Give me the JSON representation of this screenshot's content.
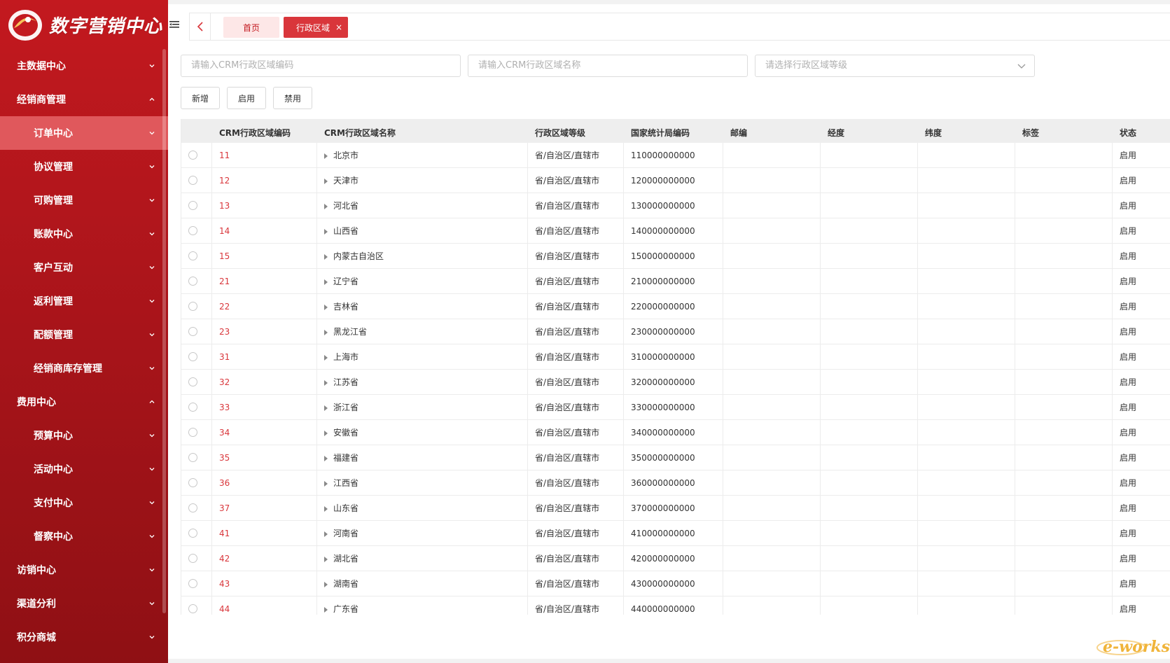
{
  "sidebar": {
    "logo_text": "数字营销中心",
    "items": [
      {
        "label": "主数据中心",
        "level": 1,
        "expanded": false
      },
      {
        "label": "经销商管理",
        "level": 1,
        "expanded": true
      },
      {
        "label": "订单中心",
        "level": 2,
        "expanded": false,
        "active": true
      },
      {
        "label": "协议管理",
        "level": 2,
        "expanded": false
      },
      {
        "label": "可购管理",
        "level": 2,
        "expanded": false
      },
      {
        "label": "账款中心",
        "level": 2,
        "expanded": false
      },
      {
        "label": "客户互动",
        "level": 2,
        "expanded": false
      },
      {
        "label": "返利管理",
        "level": 2,
        "expanded": false
      },
      {
        "label": "配额管理",
        "level": 2,
        "expanded": false
      },
      {
        "label": "经销商库存管理",
        "level": 2,
        "expanded": false
      },
      {
        "label": "费用中心",
        "level": 1,
        "expanded": true
      },
      {
        "label": "预算中心",
        "level": 2,
        "expanded": false
      },
      {
        "label": "活动中心",
        "level": 2,
        "expanded": false
      },
      {
        "label": "支付中心",
        "level": 2,
        "expanded": false
      },
      {
        "label": "督察中心",
        "level": 2,
        "expanded": false
      },
      {
        "label": "访销中心",
        "level": 1,
        "expanded": false
      },
      {
        "label": "渠道分利",
        "level": 1,
        "expanded": false
      },
      {
        "label": "积分商城",
        "level": 1,
        "expanded": false
      }
    ]
  },
  "header": {
    "tabs": [
      {
        "label": "首页",
        "active": false
      },
      {
        "label": "行政区域",
        "active": true
      }
    ]
  },
  "filters": {
    "code_placeholder": "请输入CRM行政区域编码",
    "name_placeholder": "请输入CRM行政区域名称",
    "level_placeholder": "请选择行政区域等级"
  },
  "buttons": {
    "add": "新增",
    "enable": "启用",
    "disable": "禁用"
  },
  "table": {
    "columns": [
      "CRM行政区域编码",
      "CRM行政区域名称",
      "行政区域等级",
      "国家统计局编码",
      "邮编",
      "经度",
      "纬度",
      "标签",
      "状态"
    ],
    "rows": [
      {
        "code": "11",
        "name": "北京市",
        "level": "省/自治区/直辖市",
        "stat_code": "110000000000",
        "zip": "",
        "lng": "",
        "lat": "",
        "tag": "",
        "status": "启用"
      },
      {
        "code": "12",
        "name": "天津市",
        "level": "省/自治区/直辖市",
        "stat_code": "120000000000",
        "zip": "",
        "lng": "",
        "lat": "",
        "tag": "",
        "status": "启用"
      },
      {
        "code": "13",
        "name": "河北省",
        "level": "省/自治区/直辖市",
        "stat_code": "130000000000",
        "zip": "",
        "lng": "",
        "lat": "",
        "tag": "",
        "status": "启用"
      },
      {
        "code": "14",
        "name": "山西省",
        "level": "省/自治区/直辖市",
        "stat_code": "140000000000",
        "zip": "",
        "lng": "",
        "lat": "",
        "tag": "",
        "status": "启用"
      },
      {
        "code": "15",
        "name": "内蒙古自治区",
        "level": "省/自治区/直辖市",
        "stat_code": "150000000000",
        "zip": "",
        "lng": "",
        "lat": "",
        "tag": "",
        "status": "启用"
      },
      {
        "code": "21",
        "name": "辽宁省",
        "level": "省/自治区/直辖市",
        "stat_code": "210000000000",
        "zip": "",
        "lng": "",
        "lat": "",
        "tag": "",
        "status": "启用"
      },
      {
        "code": "22",
        "name": "吉林省",
        "level": "省/自治区/直辖市",
        "stat_code": "220000000000",
        "zip": "",
        "lng": "",
        "lat": "",
        "tag": "",
        "status": "启用"
      },
      {
        "code": "23",
        "name": "黑龙江省",
        "level": "省/自治区/直辖市",
        "stat_code": "230000000000",
        "zip": "",
        "lng": "",
        "lat": "",
        "tag": "",
        "status": "启用"
      },
      {
        "code": "31",
        "name": "上海市",
        "level": "省/自治区/直辖市",
        "stat_code": "310000000000",
        "zip": "",
        "lng": "",
        "lat": "",
        "tag": "",
        "status": "启用"
      },
      {
        "code": "32",
        "name": "江苏省",
        "level": "省/自治区/直辖市",
        "stat_code": "320000000000",
        "zip": "",
        "lng": "",
        "lat": "",
        "tag": "",
        "status": "启用"
      },
      {
        "code": "33",
        "name": "浙江省",
        "level": "省/自治区/直辖市",
        "stat_code": "330000000000",
        "zip": "",
        "lng": "",
        "lat": "",
        "tag": "",
        "status": "启用"
      },
      {
        "code": "34",
        "name": "安徽省",
        "level": "省/自治区/直辖市",
        "stat_code": "340000000000",
        "zip": "",
        "lng": "",
        "lat": "",
        "tag": "",
        "status": "启用"
      },
      {
        "code": "35",
        "name": "福建省",
        "level": "省/自治区/直辖市",
        "stat_code": "350000000000",
        "zip": "",
        "lng": "",
        "lat": "",
        "tag": "",
        "status": "启用"
      },
      {
        "code": "36",
        "name": "江西省",
        "level": "省/自治区/直辖市",
        "stat_code": "360000000000",
        "zip": "",
        "lng": "",
        "lat": "",
        "tag": "",
        "status": "启用"
      },
      {
        "code": "37",
        "name": "山东省",
        "level": "省/自治区/直辖市",
        "stat_code": "370000000000",
        "zip": "",
        "lng": "",
        "lat": "",
        "tag": "",
        "status": "启用"
      },
      {
        "code": "41",
        "name": "河南省",
        "level": "省/自治区/直辖市",
        "stat_code": "410000000000",
        "zip": "",
        "lng": "",
        "lat": "",
        "tag": "",
        "status": "启用"
      },
      {
        "code": "42",
        "name": "湖北省",
        "level": "省/自治区/直辖市",
        "stat_code": "420000000000",
        "zip": "",
        "lng": "",
        "lat": "",
        "tag": "",
        "status": "启用"
      },
      {
        "code": "43",
        "name": "湖南省",
        "level": "省/自治区/直辖市",
        "stat_code": "430000000000",
        "zip": "",
        "lng": "",
        "lat": "",
        "tag": "",
        "status": "启用"
      },
      {
        "code": "44",
        "name": "广东省",
        "level": "省/自治区/直辖市",
        "stat_code": "440000000000",
        "zip": "",
        "lng": "",
        "lat": "",
        "tag": "",
        "status": "启用"
      }
    ]
  },
  "watermark": "e-works",
  "colors": {
    "brand_red": "#c3191f",
    "active_item": "#e0585c",
    "tab_active": "#d9363b",
    "tab_home_bg": "#fde7e7"
  }
}
